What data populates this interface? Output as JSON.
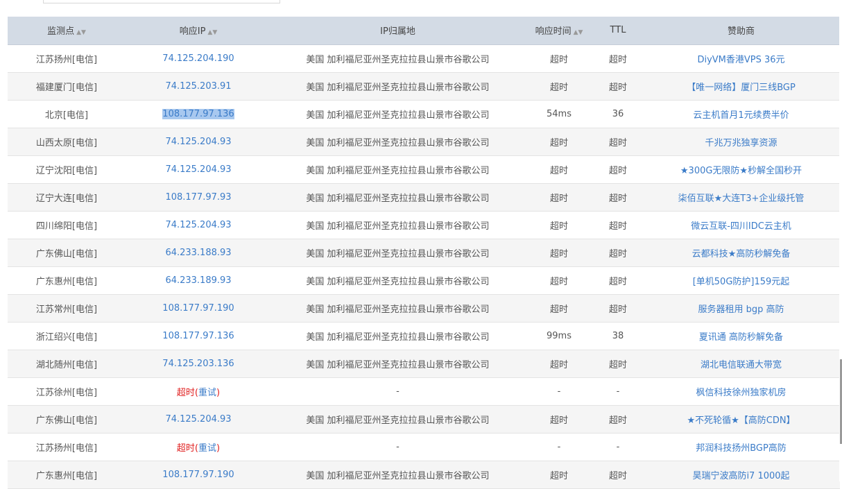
{
  "header": {
    "location": "监测点",
    "ip": "响应IP",
    "geo": "IP归属地",
    "rt": "响应时间",
    "ttl": "TTL",
    "sponsor": "赞助商"
  },
  "timeout_label": "超时",
  "retry_label": "重试",
  "dash": "-",
  "rows": [
    {
      "location": "江苏扬州[电信]",
      "ip": "74.125.204.190",
      "geo": "美国 加利福尼亚州圣克拉拉县山景市谷歌公司",
      "rt": "超时",
      "ttl": "超时",
      "sponsor": "DiyVM香港VPS 36元"
    },
    {
      "location": "福建厦门[电信]",
      "ip": "74.125.203.91",
      "geo": "美国 加利福尼亚州圣克拉拉县山景市谷歌公司",
      "rt": "超时",
      "ttl": "超时",
      "sponsor": "【唯一网络】厦门三线BGP"
    },
    {
      "location": "北京[电信]",
      "ip": "108.177.97.136",
      "geo": "美国 加利福尼亚州圣克拉拉县山景市谷歌公司",
      "rt": "54ms",
      "ttl": "36",
      "sponsor": "云主机首月1元续费半价"
    },
    {
      "location": "山西太原[电信]",
      "ip": "74.125.204.93",
      "geo": "美国 加利福尼亚州圣克拉拉县山景市谷歌公司",
      "rt": "超时",
      "ttl": "超时",
      "sponsor": "千兆万兆独享资源"
    },
    {
      "location": "辽宁沈阳[电信]",
      "ip": "74.125.204.93",
      "geo": "美国 加利福尼亚州圣克拉拉县山景市谷歌公司",
      "rt": "超时",
      "ttl": "超时",
      "sponsor": "★300G无限防★秒解全国秒开"
    },
    {
      "location": "辽宁大连[电信]",
      "ip": "108.177.97.93",
      "geo": "美国 加利福尼亚州圣克拉拉县山景市谷歌公司",
      "rt": "超时",
      "ttl": "超时",
      "sponsor": "柒佰互联★大连T3+企业级托管"
    },
    {
      "location": "四川绵阳[电信]",
      "ip": "74.125.204.93",
      "geo": "美国 加利福尼亚州圣克拉拉县山景市谷歌公司",
      "rt": "超时",
      "ttl": "超时",
      "sponsor": "微云互联-四川IDC云主机"
    },
    {
      "location": "广东佛山[电信]",
      "ip": "64.233.188.93",
      "geo": "美国 加利福尼亚州圣克拉拉县山景市谷歌公司",
      "rt": "超时",
      "ttl": "超时",
      "sponsor": "云都科技★高防秒解免备"
    },
    {
      "location": "广东惠州[电信]",
      "ip": "64.233.189.93",
      "geo": "美国 加利福尼亚州圣克拉拉县山景市谷歌公司",
      "rt": "超时",
      "ttl": "超时",
      "sponsor": "[单机50G防护]159元起"
    },
    {
      "location": "江苏常州[电信]",
      "ip": "108.177.97.190",
      "geo": "美国 加利福尼亚州圣克拉拉县山景市谷歌公司",
      "rt": "超时",
      "ttl": "超时",
      "sponsor": "服务器租用 bgp 高防"
    },
    {
      "location": "浙江绍兴[电信]",
      "ip": "108.177.97.136",
      "geo": "美国 加利福尼亚州圣克拉拉县山景市谷歌公司",
      "rt": "99ms",
      "ttl": "38",
      "sponsor": "夏讯通 高防秒解免备"
    },
    {
      "location": "湖北随州[电信]",
      "ip": "74.125.203.136",
      "geo": "美国 加利福尼亚州圣克拉拉县山景市谷歌公司",
      "rt": "超时",
      "ttl": "超时",
      "sponsor": "湖北电信联通大带宽"
    },
    {
      "location": "江苏徐州[电信]",
      "ip": "",
      "geo": "-",
      "rt": "-",
      "ttl": "-",
      "sponsor": "枫信科技徐州独家机房"
    },
    {
      "location": "广东佛山[电信]",
      "ip": "74.125.204.93",
      "geo": "美国 加利福尼亚州圣克拉拉县山景市谷歌公司",
      "rt": "超时",
      "ttl": "超时",
      "sponsor": "★不死轮循★【高防CDN】"
    },
    {
      "location": "江苏扬州[电信]",
      "ip": "",
      "geo": "-",
      "rt": "-",
      "ttl": "-",
      "sponsor": "邦润科技扬州BGP高防"
    },
    {
      "location": "广东惠州[电信]",
      "ip": "108.177.97.190",
      "geo": "美国 加利福尼亚州圣克拉拉县山景市谷歌公司",
      "rt": "超时",
      "ttl": "超时",
      "sponsor": "昊瑞宁波高防i7 1000起"
    }
  ]
}
